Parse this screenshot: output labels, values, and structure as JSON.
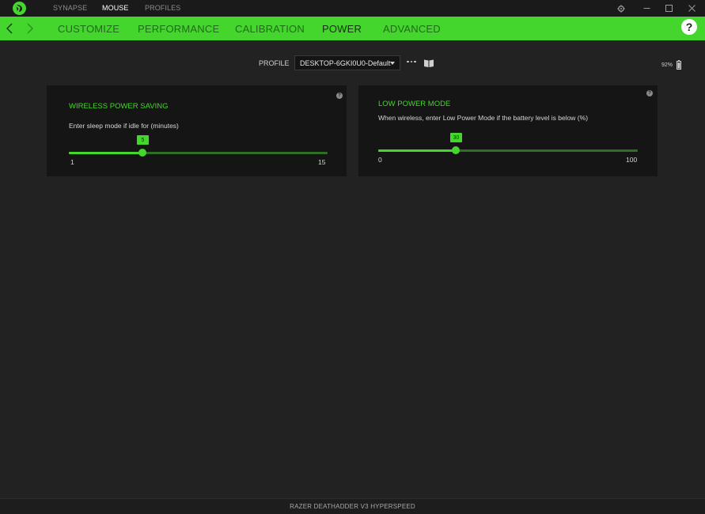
{
  "topbar": {
    "tabs": [
      {
        "label": "SYNAPSE"
      },
      {
        "label": "MOUSE"
      },
      {
        "label": "PROFILES"
      }
    ],
    "active_tab": "MOUSE",
    "window_controls": [
      "gear-icon",
      "minimize-icon",
      "maximize-icon",
      "close-icon"
    ]
  },
  "navbar": {
    "tabs": [
      {
        "label": "CUSTOMIZE"
      },
      {
        "label": "PERFORMANCE"
      },
      {
        "label": "CALIBRATION"
      },
      {
        "label": "POWER"
      },
      {
        "label": "ADVANCED"
      }
    ],
    "active_tab": "POWER",
    "help_label": "?"
  },
  "profile": {
    "label": "PROFILE",
    "selected": "DESKTOP-6GKI0U0-Default"
  },
  "battery": {
    "percent_text": "92%",
    "level": 0.92
  },
  "panels": {
    "wireless_power_saving": {
      "title": "WIRELESS POWER SAVING",
      "description": "Enter sleep mode if idle for (minutes)",
      "value": "5",
      "min": "1",
      "max": "15",
      "fraction": 0.2857
    },
    "low_power_mode": {
      "title": "LOW POWER MODE",
      "description": "When wireless, enter Low Power Mode if the battery level is below (%)",
      "value": "30",
      "min": "0",
      "max": "100",
      "fraction": 0.3
    }
  },
  "footer": {
    "device_name": "RAZER DEATHADDER V3 HYPERSPEED"
  },
  "colors": {
    "accent": "#44d62c",
    "background": "#222222",
    "panel": "#151515"
  }
}
